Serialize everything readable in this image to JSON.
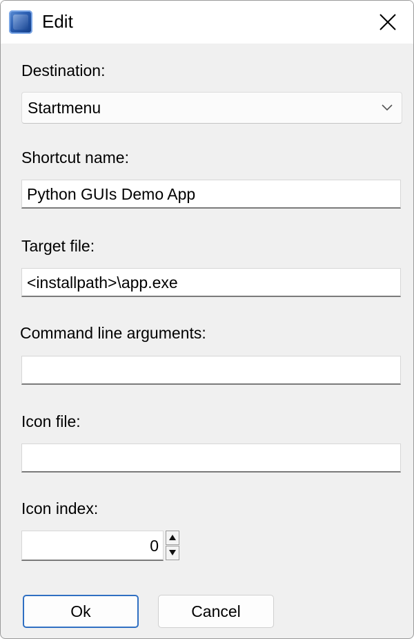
{
  "window": {
    "title": "Edit"
  },
  "icons": {
    "app": "app-icon",
    "close": "close-icon",
    "dropdown": "chevron-down-icon",
    "spin_up": "arrow-up-icon",
    "spin_down": "arrow-down-icon"
  },
  "form": {
    "destination": {
      "label": "Destination:",
      "value": "Startmenu"
    },
    "shortcut_name": {
      "label": "Shortcut name:",
      "value": "Python GUIs Demo App"
    },
    "target_file": {
      "label": "Target file:",
      "value": "<installpath>\\app.exe"
    },
    "command_line_arguments": {
      "label": "Command line arguments:",
      "value": ""
    },
    "icon_file": {
      "label": "Icon file:",
      "value": ""
    },
    "icon_index": {
      "label": "Icon index:",
      "value": "0"
    }
  },
  "buttons": {
    "ok": "Ok",
    "cancel": "Cancel"
  },
  "colors": {
    "accent": "#2f6fc2",
    "background": "#f0f0f0"
  }
}
